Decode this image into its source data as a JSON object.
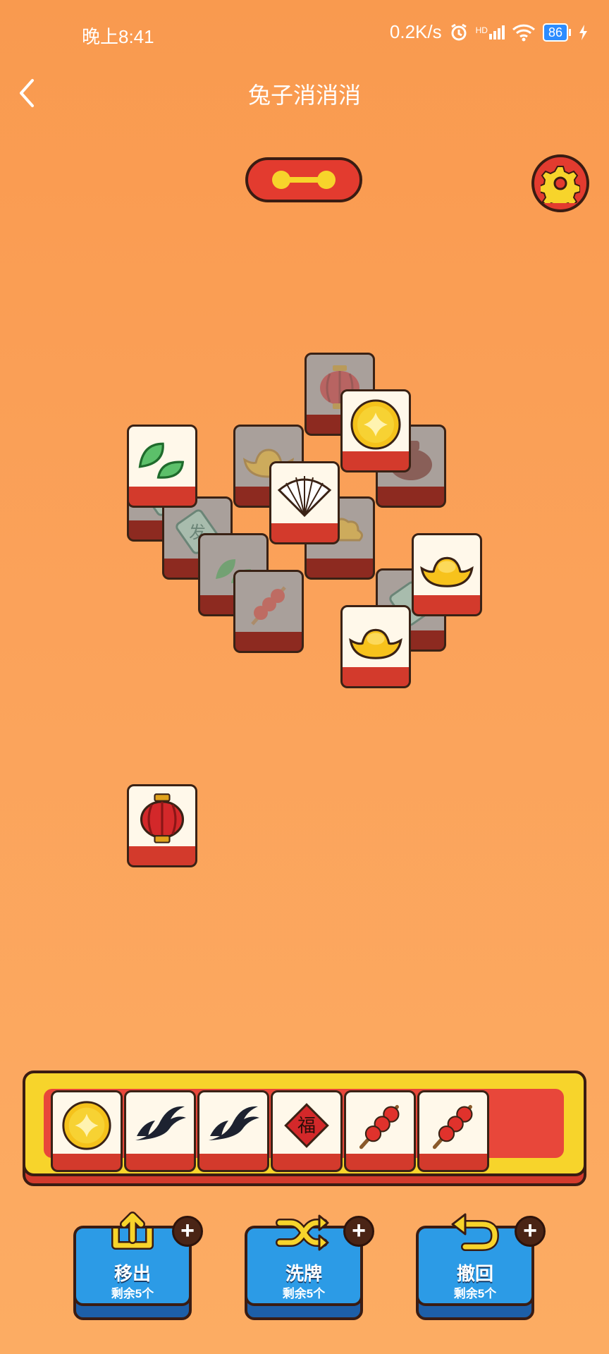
{
  "status_bar": {
    "time": "晚上8:41",
    "net_speed": "0.2K/s",
    "signal_label": "HD",
    "battery": "86"
  },
  "header": {
    "title": "兔子消消消",
    "back_icon": "chevron-left-icon"
  },
  "top_controls": {
    "progress_icon": "level-progress-icon",
    "settings_icon": "gear-icon"
  },
  "board": {
    "tiles": [
      {
        "item": "lantern",
        "state": "covered"
      },
      {
        "item": "mahjong",
        "state": "covered"
      },
      {
        "item": "mahjong",
        "state": "covered"
      },
      {
        "item": "tanghulu",
        "state": "covered"
      },
      {
        "item": "leaf",
        "state": "covered"
      },
      {
        "item": "gold-ingot",
        "state": "covered"
      },
      {
        "item": "cloud",
        "state": "covered"
      },
      {
        "item": "clay-pot",
        "state": "covered"
      },
      {
        "item": "mahjong",
        "state": "covered"
      },
      {
        "item": "leaf",
        "state": "open"
      },
      {
        "item": "coin",
        "state": "open"
      },
      {
        "item": "fan",
        "state": "open"
      },
      {
        "item": "gold-ingot",
        "state": "open"
      },
      {
        "item": "gold-ingot",
        "state": "open"
      },
      {
        "item": "lantern",
        "state": "open"
      }
    ]
  },
  "tray": {
    "capacity": 7,
    "slots": [
      "coin",
      "swallow",
      "swallow",
      "fu",
      "tanghulu",
      "tanghulu"
    ]
  },
  "tools": [
    {
      "name": "remove",
      "label": "移出",
      "remaining": "剩余5个",
      "icon": "move-out-icon"
    },
    {
      "name": "shuffle",
      "label": "洗牌",
      "remaining": "剩余5个",
      "icon": "shuffle-icon"
    },
    {
      "name": "undo",
      "label": "撤回",
      "remaining": "剩余5个",
      "icon": "undo-icon"
    }
  ],
  "colors": {
    "background": "#fba25a",
    "tile_face": "#fff8ea",
    "tile_edge": "#d33a2c",
    "tray_frame": "#f7d42b",
    "tool_button": "#2c9be6",
    "outline": "#3a2215"
  }
}
